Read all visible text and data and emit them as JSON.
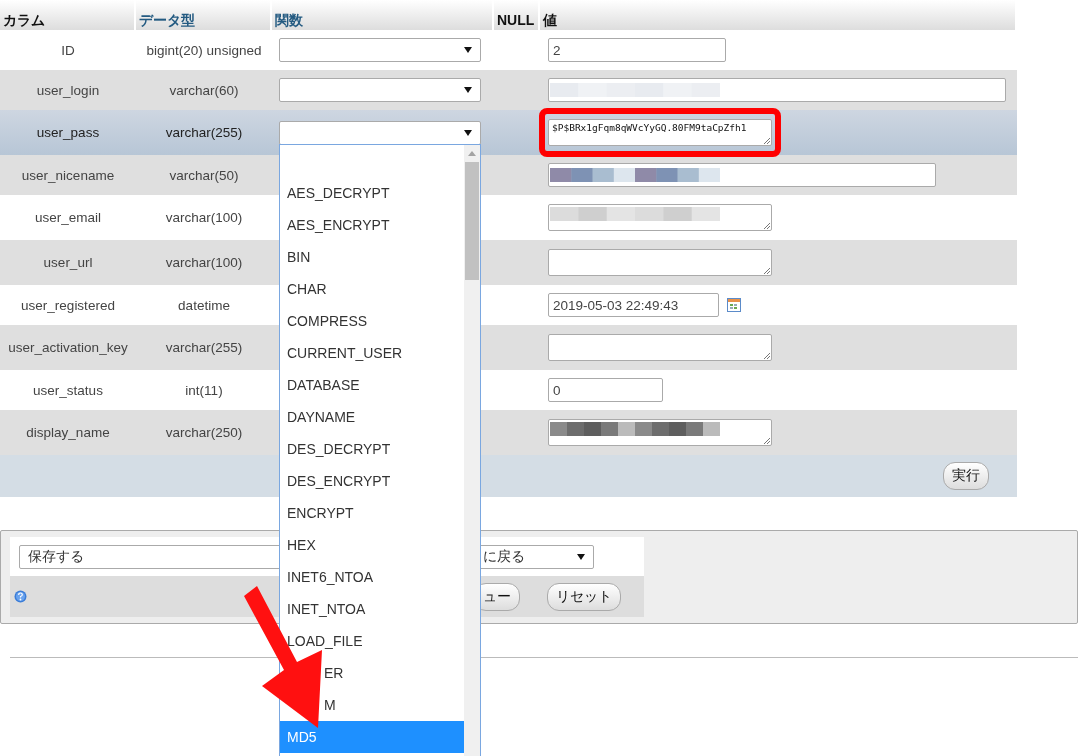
{
  "header": [
    {
      "label": "カラム",
      "kind": "plain"
    },
    {
      "label": "データ型",
      "kind": "link"
    },
    {
      "label": "関数",
      "kind": "link"
    },
    {
      "label": "NULL",
      "kind": "plain"
    },
    {
      "label": "値",
      "kind": "plain"
    }
  ],
  "rows": [
    {
      "column": "ID",
      "type": "bigint(20) unsigned",
      "function_select": true,
      "selected": false,
      "value": {
        "kind": "short",
        "text": "2"
      }
    },
    {
      "column": "user_login",
      "type": "varchar(60)",
      "function_select": true,
      "selected": false,
      "value": {
        "kind": "wide",
        "redacted": true
      }
    },
    {
      "column": "user_pass",
      "type": "varchar(255)",
      "function_select": true,
      "selected": true,
      "value": {
        "kind": "textarea",
        "text": "$P$BRx1gFqm8qWVcYyGQ.80FM9taCpZfh1",
        "highlighted": true
      }
    },
    {
      "column": "user_nicename",
      "type": "varchar(50)",
      "selected": false,
      "value": {
        "kind": "medium",
        "redacted": true
      }
    },
    {
      "column": "user_email",
      "type": "varchar(100)",
      "selected": false,
      "value": {
        "kind": "textarea",
        "redacted": true
      }
    },
    {
      "column": "user_url",
      "type": "varchar(100)",
      "selected": false,
      "value": {
        "kind": "textarea"
      }
    },
    {
      "column": "user_registered",
      "type": "datetime",
      "selected": false,
      "value": {
        "kind": "date",
        "text": "2019-05-03 22:49:43"
      }
    },
    {
      "column": "user_activation_key",
      "type": "varchar(255)",
      "selected": false,
      "value": {
        "kind": "textarea"
      }
    },
    {
      "column": "user_status",
      "type": "int(11)",
      "selected": false,
      "value": {
        "kind": "small",
        "text": "0"
      }
    },
    {
      "column": "display_name",
      "type": "varchar(250)",
      "selected": false,
      "value": {
        "kind": "textarea",
        "redacted": true
      }
    }
  ],
  "submit": "実行",
  "bottom": {
    "save_select": "保存する",
    "return_select": "に戻る",
    "buttons": [
      "ュー",
      "リセット"
    ]
  },
  "dropdown": {
    "items": [
      {
        "label": "AES_DECRYPT",
        "selected": false
      },
      {
        "label": "AES_ENCRYPT",
        "selected": false
      },
      {
        "label": "BIN",
        "selected": false
      },
      {
        "label": "CHAR",
        "selected": false
      },
      {
        "label": "COMPRESS",
        "selected": false
      },
      {
        "label": "CURRENT_USER",
        "selected": false
      },
      {
        "label": "DATABASE",
        "selected": false
      },
      {
        "label": "DAYNAME",
        "selected": false
      },
      {
        "label": "DES_DECRYPT",
        "selected": false
      },
      {
        "label": "DES_ENCRYPT",
        "selected": false
      },
      {
        "label": "ENCRYPT",
        "selected": false
      },
      {
        "label": "HEX",
        "selected": false
      },
      {
        "label": "INET6_NTOA",
        "selected": false
      },
      {
        "label": "INET_NTOA",
        "selected": false
      },
      {
        "label": "LOAD_FILE",
        "selected": false
      },
      {
        "label": "ER",
        "kind": "covered",
        "selected": false
      },
      {
        "label": "M",
        "kind": "covered",
        "selected": false
      },
      {
        "label": "MD5",
        "selected": true
      }
    ]
  },
  "annotation_arrow": true
}
